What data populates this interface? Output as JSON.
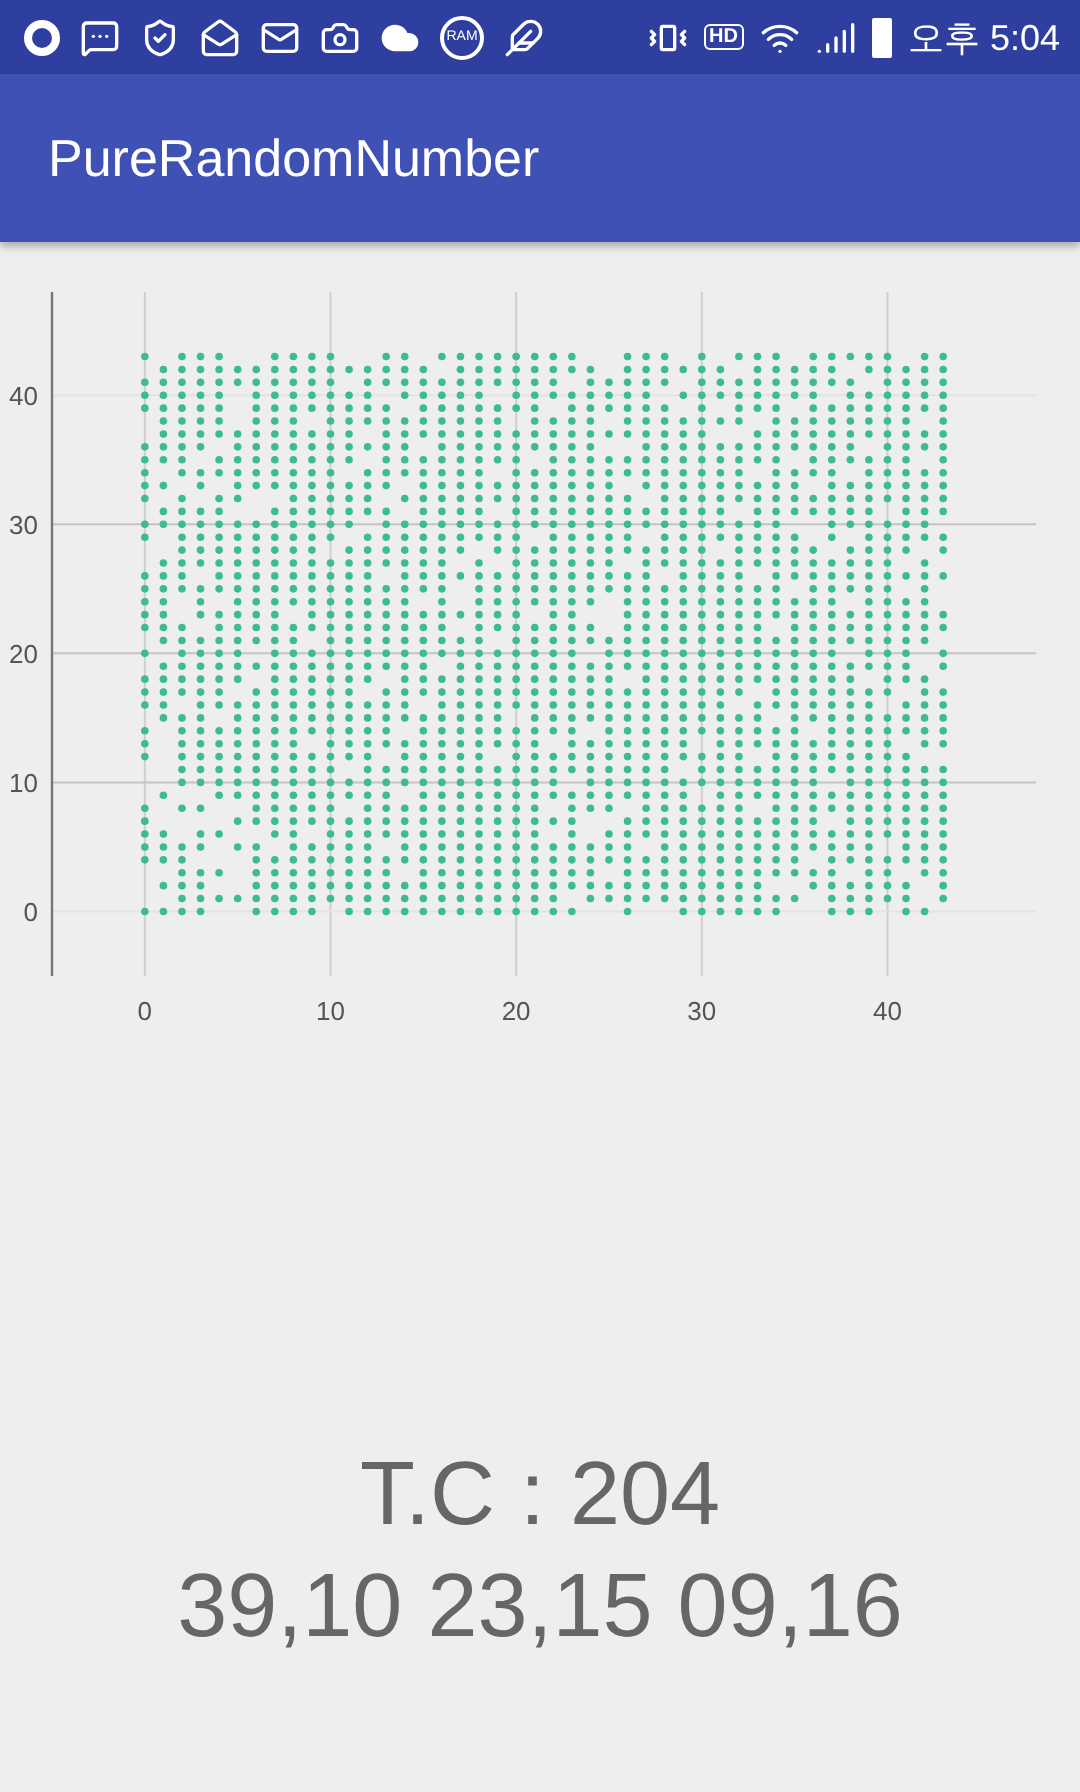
{
  "status_bar": {
    "ram_label": "RAM",
    "hd_label": "HD",
    "time": "오후 5:04"
  },
  "app_bar": {
    "title": "PureRandomNumber"
  },
  "chart": {
    "chart_data": {
      "type": "scatter",
      "grid": true,
      "xlim": [
        -5,
        48
      ],
      "ylim": [
        -5,
        48
      ],
      "x": [
        0,
        1,
        2,
        3,
        4,
        5,
        6,
        7,
        8,
        9,
        10,
        11,
        12,
        13,
        14,
        15,
        16,
        17,
        18,
        19,
        20,
        21,
        22,
        23,
        24,
        25,
        26,
        27,
        28,
        29,
        30,
        31,
        32,
        33,
        34,
        35,
        36,
        37,
        38,
        39,
        40,
        41,
        42,
        43
      ],
      "xticks": [
        {
          "value": 0,
          "label": "0"
        },
        {
          "value": 10,
          "label": "10"
        },
        {
          "value": 20,
          "label": "20"
        },
        {
          "value": 30,
          "label": "30"
        },
        {
          "value": 40,
          "label": "40"
        }
      ],
      "yticks": [
        {
          "value": 0,
          "label": "0"
        },
        {
          "value": 10,
          "label": "10"
        },
        {
          "value": 20,
          "label": "20"
        },
        {
          "value": 30,
          "label": "30"
        },
        {
          "value": 40,
          "label": "40"
        }
      ],
      "series": [
        {
          "color": "#3dbb92",
          "values": [
            43,
            null,
            43,
            43,
            43,
            null,
            null,
            43,
            43,
            43,
            43,
            null,
            null,
            43,
            43,
            null,
            43,
            43,
            43,
            43,
            43,
            43,
            43,
            43,
            null,
            null,
            43,
            43,
            43,
            null,
            43,
            null,
            43,
            43,
            43,
            null,
            43,
            43,
            43,
            43,
            43,
            null,
            43,
            43
          ]
        },
        {
          "color": "#3dbb92",
          "values": [
            null,
            42,
            42,
            42,
            42,
            42,
            42,
            42,
            42,
            42,
            42,
            42,
            42,
            42,
            42,
            42,
            null,
            42,
            42,
            42,
            42,
            42,
            42,
            42,
            42,
            null,
            42,
            42,
            42,
            42,
            42,
            42,
            null,
            42,
            42,
            42,
            42,
            42,
            null,
            42,
            42,
            42,
            42,
            42
          ]
        },
        {
          "color": "#3dbb92",
          "values": [
            41,
            41,
            41,
            41,
            41,
            41,
            41,
            41,
            41,
            41,
            41,
            null,
            41,
            41,
            41,
            41,
            41,
            41,
            41,
            41,
            41,
            41,
            41,
            null,
            41,
            41,
            41,
            41,
            41,
            null,
            41,
            41,
            41,
            41,
            41,
            41,
            41,
            41,
            41,
            null,
            41,
            41,
            41,
            41
          ]
        },
        {
          "color": "#3dbb92",
          "values": [
            40,
            40,
            40,
            40,
            40,
            null,
            40,
            40,
            40,
            40,
            40,
            40,
            40,
            null,
            40,
            40,
            40,
            40,
            40,
            null,
            40,
            40,
            40,
            40,
            40,
            40,
            40,
            40,
            null,
            40,
            40,
            40,
            40,
            40,
            40,
            40,
            40,
            null,
            40,
            40,
            40,
            40,
            40,
            40
          ]
        },
        {
          "color": "#3dbb92",
          "values": [
            39,
            39,
            39,
            39,
            39,
            null,
            39,
            39,
            39,
            39,
            39,
            39,
            39,
            39,
            null,
            39,
            39,
            39,
            39,
            39,
            39,
            39,
            null,
            39,
            39,
            39,
            39,
            39,
            39,
            null,
            39,
            null,
            39,
            39,
            39,
            null,
            39,
            39,
            39,
            39,
            39,
            39,
            39,
            39
          ]
        },
        {
          "color": "#3dbb92",
          "values": [
            null,
            38,
            38,
            38,
            38,
            null,
            38,
            38,
            38,
            null,
            38,
            38,
            38,
            38,
            38,
            38,
            38,
            38,
            38,
            38,
            null,
            38,
            38,
            38,
            38,
            null,
            38,
            38,
            38,
            38,
            38,
            38,
            38,
            null,
            38,
            38,
            38,
            38,
            38,
            38,
            38,
            38,
            null,
            38
          ]
        },
        {
          "color": "#3dbb92",
          "values": [
            null,
            37,
            37,
            37,
            37,
            37,
            37,
            37,
            37,
            37,
            37,
            37,
            null,
            37,
            37,
            37,
            37,
            37,
            37,
            37,
            37,
            37,
            37,
            37,
            37,
            37,
            37,
            37,
            37,
            37,
            37,
            null,
            null,
            37,
            37,
            37,
            37,
            37,
            37,
            37,
            37,
            37,
            37,
            37
          ]
        },
        {
          "color": "#3dbb92",
          "values": [
            36,
            36,
            36,
            36,
            null,
            36,
            36,
            36,
            36,
            36,
            36,
            36,
            36,
            36,
            36,
            null,
            36,
            36,
            36,
            36,
            36,
            36,
            36,
            36,
            36,
            null,
            null,
            36,
            36,
            36,
            36,
            36,
            36,
            36,
            36,
            36,
            36,
            36,
            36,
            null,
            36,
            36,
            36,
            36
          ]
        },
        {
          "color": "#3dbb92",
          "values": [
            35,
            35,
            35,
            null,
            35,
            35,
            35,
            35,
            35,
            35,
            35,
            35,
            null,
            35,
            35,
            35,
            35,
            35,
            35,
            35,
            35,
            null,
            35,
            35,
            35,
            35,
            35,
            35,
            35,
            35,
            35,
            35,
            35,
            35,
            35,
            null,
            35,
            35,
            35,
            35,
            35,
            35,
            null,
            35
          ]
        },
        {
          "color": "#3dbb92",
          "values": [
            34,
            null,
            34,
            34,
            34,
            34,
            34,
            34,
            34,
            34,
            34,
            null,
            34,
            34,
            34,
            34,
            34,
            34,
            34,
            null,
            34,
            34,
            34,
            34,
            34,
            34,
            34,
            34,
            34,
            34,
            34,
            34,
            34,
            null,
            34,
            34,
            34,
            34,
            null,
            34,
            34,
            34,
            34,
            34
          ]
        },
        {
          "color": "#3dbb92",
          "values": [
            33,
            33,
            null,
            33,
            null,
            33,
            33,
            33,
            33,
            33,
            33,
            33,
            33,
            33,
            null,
            33,
            33,
            33,
            33,
            33,
            33,
            33,
            33,
            33,
            33,
            33,
            null,
            33,
            33,
            33,
            33,
            33,
            33,
            33,
            33,
            33,
            null,
            33,
            33,
            33,
            33,
            33,
            33,
            33
          ]
        },
        {
          "color": "#3dbb92",
          "values": [
            32,
            null,
            32,
            null,
            32,
            32,
            null,
            null,
            32,
            32,
            32,
            32,
            32,
            null,
            32,
            32,
            32,
            32,
            32,
            32,
            32,
            32,
            32,
            32,
            32,
            32,
            32,
            null,
            32,
            32,
            32,
            32,
            32,
            32,
            32,
            32,
            32,
            32,
            32,
            32,
            32,
            32,
            32,
            32
          ]
        },
        {
          "color": "#3dbb92",
          "values": [
            null,
            31,
            31,
            31,
            31,
            null,
            null,
            31,
            31,
            31,
            31,
            31,
            31,
            31,
            null,
            31,
            31,
            31,
            31,
            null,
            31,
            31,
            31,
            31,
            31,
            31,
            31,
            31,
            31,
            31,
            31,
            31,
            null,
            31,
            31,
            31,
            31,
            31,
            31,
            31,
            null,
            31,
            31,
            31
          ]
        },
        {
          "color": "#3dbb92",
          "values": [
            30,
            30,
            30,
            30,
            30,
            30,
            30,
            30,
            30,
            30,
            30,
            30,
            null,
            30,
            30,
            30,
            30,
            30,
            30,
            30,
            30,
            30,
            30,
            30,
            30,
            30,
            30,
            30,
            30,
            30,
            30,
            30,
            30,
            30,
            30,
            null,
            null,
            30,
            30,
            30,
            30,
            30,
            30,
            null
          ]
        },
        {
          "color": "#3dbb92",
          "values": [
            29,
            null,
            29,
            29,
            29,
            29,
            29,
            29,
            29,
            29,
            29,
            null,
            29,
            29,
            29,
            29,
            29,
            29,
            29,
            29,
            29,
            null,
            29,
            29,
            29,
            29,
            29,
            null,
            29,
            29,
            29,
            29,
            29,
            29,
            29,
            29,
            null,
            29,
            null,
            29,
            29,
            29,
            29,
            29
          ]
        },
        {
          "color": "#3dbb92",
          "values": [
            null,
            null,
            28,
            28,
            28,
            28,
            28,
            28,
            28,
            28,
            null,
            28,
            28,
            28,
            28,
            28,
            28,
            28,
            null,
            28,
            28,
            28,
            28,
            28,
            28,
            28,
            28,
            28,
            28,
            28,
            28,
            null,
            28,
            28,
            28,
            28,
            28,
            null,
            28,
            28,
            28,
            28,
            null,
            28
          ]
        },
        {
          "color": "#3dbb92",
          "values": [
            null,
            27,
            27,
            27,
            27,
            27,
            27,
            27,
            27,
            27,
            27,
            27,
            27,
            27,
            27,
            27,
            27,
            null,
            27,
            null,
            27,
            27,
            27,
            27,
            27,
            27,
            null,
            27,
            27,
            27,
            27,
            27,
            27,
            27,
            27,
            27,
            27,
            27,
            27,
            27,
            27,
            null,
            27,
            null
          ]
        },
        {
          "color": "#3dbb92",
          "values": [
            26,
            26,
            26,
            null,
            26,
            26,
            26,
            26,
            26,
            26,
            26,
            26,
            26,
            null,
            26,
            26,
            26,
            26,
            26,
            26,
            26,
            26,
            26,
            26,
            26,
            26,
            26,
            26,
            null,
            26,
            26,
            26,
            26,
            null,
            26,
            26,
            26,
            26,
            26,
            26,
            26,
            26,
            26,
            26
          ]
        },
        {
          "color": "#3dbb92",
          "values": [
            25,
            25,
            25,
            25,
            25,
            25,
            25,
            25,
            25,
            25,
            25,
            25,
            25,
            25,
            25,
            25,
            25,
            null,
            25,
            25,
            25,
            25,
            25,
            25,
            25,
            25,
            25,
            25,
            25,
            25,
            25,
            25,
            25,
            25,
            25,
            null,
            25,
            25,
            25,
            25,
            25,
            null,
            25,
            null
          ]
        },
        {
          "color": "#3dbb92",
          "values": [
            24,
            24,
            null,
            24,
            null,
            24,
            24,
            24,
            24,
            24,
            24,
            24,
            24,
            24,
            24,
            null,
            24,
            null,
            24,
            24,
            24,
            24,
            24,
            24,
            24,
            null,
            24,
            24,
            24,
            24,
            24,
            24,
            24,
            24,
            24,
            24,
            24,
            24,
            null,
            24,
            24,
            24,
            24,
            null
          ]
        },
        {
          "color": "#3dbb92",
          "values": [
            23,
            23,
            null,
            23,
            23,
            23,
            23,
            23,
            null,
            23,
            23,
            23,
            23,
            23,
            23,
            23,
            23,
            23,
            23,
            23,
            23,
            null,
            23,
            23,
            null,
            null,
            23,
            23,
            23,
            23,
            23,
            23,
            23,
            23,
            23,
            23,
            23,
            23,
            23,
            23,
            23,
            23,
            23,
            23
          ]
        },
        {
          "color": "#3dbb92",
          "values": [
            22,
            22,
            22,
            null,
            22,
            22,
            22,
            22,
            22,
            22,
            22,
            22,
            22,
            22,
            22,
            22,
            22,
            null,
            22,
            22,
            22,
            22,
            22,
            22,
            22,
            null,
            22,
            22,
            22,
            22,
            22,
            22,
            22,
            22,
            null,
            22,
            22,
            22,
            22,
            22,
            22,
            22,
            22,
            22
          ]
        },
        {
          "color": "#3dbb92",
          "values": [
            null,
            21,
            21,
            21,
            21,
            21,
            21,
            21,
            21,
            null,
            21,
            21,
            21,
            21,
            21,
            21,
            21,
            21,
            21,
            null,
            21,
            21,
            21,
            21,
            21,
            21,
            21,
            21,
            21,
            21,
            21,
            21,
            21,
            21,
            21,
            21,
            21,
            21,
            21,
            21,
            21,
            21,
            21,
            null
          ]
        },
        {
          "color": "#3dbb92",
          "values": [
            20,
            null,
            20,
            20,
            20,
            20,
            null,
            20,
            20,
            20,
            20,
            20,
            20,
            20,
            20,
            20,
            20,
            20,
            20,
            20,
            20,
            20,
            20,
            20,
            null,
            20,
            20,
            20,
            20,
            20,
            20,
            20,
            20,
            20,
            20,
            20,
            20,
            20,
            null,
            20,
            20,
            20,
            null,
            20
          ]
        },
        {
          "color": "#3dbb92",
          "values": [
            null,
            19,
            19,
            19,
            19,
            19,
            19,
            19,
            19,
            19,
            19,
            19,
            19,
            19,
            19,
            19,
            null,
            19,
            19,
            19,
            19,
            19,
            19,
            19,
            19,
            19,
            19,
            19,
            19,
            19,
            19,
            19,
            19,
            19,
            19,
            19,
            19,
            19,
            19,
            19,
            19,
            19,
            null,
            19
          ]
        },
        {
          "color": "#3dbb92",
          "values": [
            18,
            18,
            18,
            18,
            18,
            18,
            null,
            18,
            18,
            18,
            18,
            18,
            18,
            null,
            18,
            18,
            18,
            18,
            18,
            18,
            18,
            18,
            18,
            18,
            18,
            18,
            null,
            18,
            18,
            18,
            18,
            18,
            18,
            18,
            18,
            18,
            18,
            18,
            18,
            null,
            18,
            18,
            18,
            null
          ]
        },
        {
          "color": "#3dbb92",
          "values": [
            17,
            17,
            17,
            17,
            17,
            null,
            17,
            17,
            17,
            17,
            17,
            17,
            null,
            17,
            17,
            17,
            17,
            17,
            17,
            17,
            17,
            17,
            17,
            17,
            17,
            17,
            17,
            17,
            17,
            17,
            17,
            17,
            17,
            null,
            17,
            17,
            17,
            17,
            17,
            17,
            17,
            null,
            17,
            17
          ]
        },
        {
          "color": "#3dbb92",
          "values": [
            16,
            16,
            null,
            16,
            16,
            16,
            16,
            16,
            16,
            16,
            16,
            16,
            16,
            16,
            16,
            null,
            16,
            16,
            16,
            16,
            16,
            16,
            16,
            16,
            16,
            16,
            16,
            16,
            16,
            16,
            16,
            16,
            null,
            16,
            16,
            16,
            16,
            16,
            16,
            16,
            null,
            16,
            16,
            16
          ]
        },
        {
          "color": "#3dbb92",
          "values": [
            null,
            15,
            15,
            15,
            null,
            15,
            15,
            15,
            15,
            15,
            15,
            15,
            15,
            15,
            15,
            15,
            15,
            15,
            15,
            15,
            null,
            15,
            15,
            15,
            15,
            15,
            15,
            15,
            15,
            15,
            15,
            15,
            15,
            15,
            null,
            15,
            15,
            15,
            15,
            15,
            15,
            15,
            15,
            15
          ]
        },
        {
          "color": "#3dbb92",
          "values": [
            14,
            null,
            14,
            14,
            14,
            14,
            14,
            14,
            14,
            14,
            14,
            14,
            14,
            14,
            null,
            14,
            14,
            14,
            14,
            14,
            14,
            14,
            14,
            14,
            null,
            14,
            14,
            14,
            14,
            14,
            14,
            14,
            14,
            14,
            14,
            14,
            null,
            14,
            14,
            14,
            14,
            14,
            14,
            14
          ]
        },
        {
          "color": "#3dbb92",
          "values": [
            13,
            null,
            13,
            13,
            13,
            13,
            13,
            13,
            13,
            null,
            13,
            13,
            13,
            13,
            13,
            13,
            13,
            13,
            13,
            13,
            13,
            13,
            null,
            13,
            13,
            13,
            13,
            13,
            13,
            13,
            null,
            13,
            13,
            13,
            13,
            13,
            13,
            13,
            13,
            13,
            13,
            null,
            13,
            13
          ]
        },
        {
          "color": "#3dbb92",
          "values": [
            12,
            null,
            12,
            12,
            12,
            12,
            12,
            12,
            12,
            12,
            12,
            12,
            12,
            null,
            12,
            12,
            12,
            12,
            12,
            null,
            12,
            12,
            12,
            12,
            12,
            12,
            12,
            12,
            12,
            12,
            12,
            12,
            12,
            null,
            12,
            12,
            12,
            12,
            12,
            12,
            12,
            12,
            null,
            null
          ]
        },
        {
          "color": "#3dbb92",
          "values": [
            null,
            null,
            11,
            11,
            11,
            11,
            11,
            11,
            11,
            11,
            11,
            null,
            11,
            11,
            11,
            11,
            11,
            11,
            11,
            11,
            11,
            11,
            11,
            11,
            11,
            11,
            11,
            11,
            11,
            null,
            11,
            11,
            11,
            11,
            11,
            11,
            11,
            11,
            11,
            11,
            11,
            11,
            11,
            11
          ]
        },
        {
          "color": "#3dbb92",
          "values": [
            null,
            null,
            10,
            10,
            10,
            10,
            10,
            10,
            10,
            10,
            10,
            10,
            10,
            10,
            10,
            10,
            10,
            10,
            10,
            10,
            10,
            10,
            10,
            null,
            10,
            10,
            10,
            10,
            10,
            10,
            10,
            10,
            10,
            10,
            10,
            10,
            10,
            null,
            10,
            10,
            10,
            10,
            10,
            10
          ]
        },
        {
          "color": "#3dbb92",
          "values": [
            null,
            9,
            null,
            null,
            9,
            9,
            9,
            9,
            9,
            9,
            9,
            9,
            9,
            9,
            null,
            9,
            9,
            9,
            9,
            9,
            9,
            9,
            9,
            9,
            9,
            9,
            9,
            9,
            9,
            9,
            null,
            9,
            9,
            9,
            9,
            9,
            9,
            9,
            9,
            9,
            9,
            9,
            9,
            9
          ]
        },
        {
          "color": "#3dbb92",
          "values": [
            8,
            null,
            8,
            8,
            null,
            null,
            8,
            8,
            8,
            8,
            8,
            null,
            8,
            8,
            8,
            8,
            8,
            8,
            8,
            8,
            8,
            8,
            null,
            8,
            8,
            8,
            null,
            8,
            8,
            8,
            8,
            8,
            8,
            null,
            8,
            8,
            8,
            8,
            8,
            8,
            8,
            8,
            8,
            8
          ]
        },
        {
          "color": "#3dbb92",
          "values": [
            7,
            null,
            null,
            null,
            null,
            7,
            7,
            7,
            7,
            7,
            7,
            7,
            7,
            7,
            7,
            7,
            7,
            7,
            7,
            7,
            7,
            7,
            7,
            7,
            null,
            null,
            7,
            7,
            7,
            7,
            7,
            7,
            7,
            7,
            7,
            7,
            7,
            null,
            7,
            7,
            7,
            7,
            7,
            7
          ]
        },
        {
          "color": "#3dbb92",
          "values": [
            6,
            6,
            null,
            6,
            6,
            null,
            null,
            6,
            6,
            null,
            6,
            6,
            6,
            6,
            6,
            6,
            6,
            6,
            6,
            6,
            6,
            6,
            null,
            6,
            null,
            6,
            6,
            6,
            6,
            6,
            6,
            6,
            6,
            6,
            6,
            6,
            6,
            6,
            6,
            6,
            6,
            6,
            6,
            6
          ]
        },
        {
          "color": "#3dbb92",
          "values": [
            5,
            5,
            5,
            5,
            null,
            5,
            5,
            null,
            5,
            5,
            5,
            5,
            5,
            null,
            5,
            5,
            5,
            5,
            5,
            5,
            5,
            5,
            5,
            5,
            5,
            5,
            5,
            null,
            5,
            5,
            5,
            5,
            5,
            5,
            5,
            5,
            5,
            5,
            5,
            5,
            null,
            5,
            5,
            5
          ]
        },
        {
          "color": "#3dbb92",
          "values": [
            4,
            4,
            4,
            null,
            null,
            null,
            4,
            4,
            4,
            4,
            4,
            4,
            4,
            4,
            4,
            4,
            4,
            4,
            4,
            4,
            4,
            4,
            4,
            4,
            4,
            4,
            4,
            4,
            4,
            4,
            4,
            4,
            4,
            4,
            4,
            4,
            null,
            4,
            4,
            4,
            4,
            4,
            4,
            4
          ]
        },
        {
          "color": "#3dbb92",
          "values": [
            null,
            null,
            3,
            3,
            3,
            null,
            3,
            3,
            3,
            3,
            3,
            3,
            3,
            3,
            null,
            3,
            3,
            3,
            3,
            3,
            3,
            3,
            3,
            3,
            3,
            null,
            3,
            3,
            3,
            3,
            3,
            3,
            3,
            3,
            3,
            3,
            3,
            3,
            null,
            3,
            3,
            null,
            3,
            3
          ]
        },
        {
          "color": "#3dbb92",
          "values": [
            null,
            2,
            2,
            2,
            null,
            null,
            2,
            2,
            2,
            2,
            2,
            2,
            2,
            2,
            2,
            2,
            2,
            2,
            2,
            2,
            2,
            2,
            2,
            2,
            2,
            2,
            2,
            2,
            2,
            2,
            2,
            2,
            2,
            2,
            null,
            null,
            2,
            2,
            2,
            2,
            2,
            2,
            null,
            2
          ]
        },
        {
          "color": "#3dbb92",
          "values": [
            null,
            null,
            1,
            1,
            1,
            1,
            1,
            1,
            1,
            1,
            1,
            1,
            1,
            1,
            1,
            1,
            1,
            1,
            1,
            1,
            1,
            1,
            1,
            null,
            1,
            1,
            1,
            1,
            1,
            1,
            1,
            1,
            1,
            1,
            1,
            1,
            null,
            1,
            1,
            1,
            1,
            1,
            null,
            1
          ]
        },
        {
          "color": "#3dbb92",
          "values": [
            0,
            0,
            0,
            0,
            null,
            null,
            0,
            0,
            0,
            0,
            null,
            0,
            0,
            0,
            0,
            0,
            0,
            0,
            0,
            0,
            0,
            0,
            0,
            0,
            null,
            null,
            0,
            null,
            null,
            0,
            0,
            0,
            0,
            0,
            0,
            null,
            null,
            0,
            0,
            0,
            null,
            0,
            0,
            null
          ]
        }
      ]
    }
  },
  "result": {
    "count": "T.C : 204",
    "pairs": "39,10 23,15 09,16"
  }
}
